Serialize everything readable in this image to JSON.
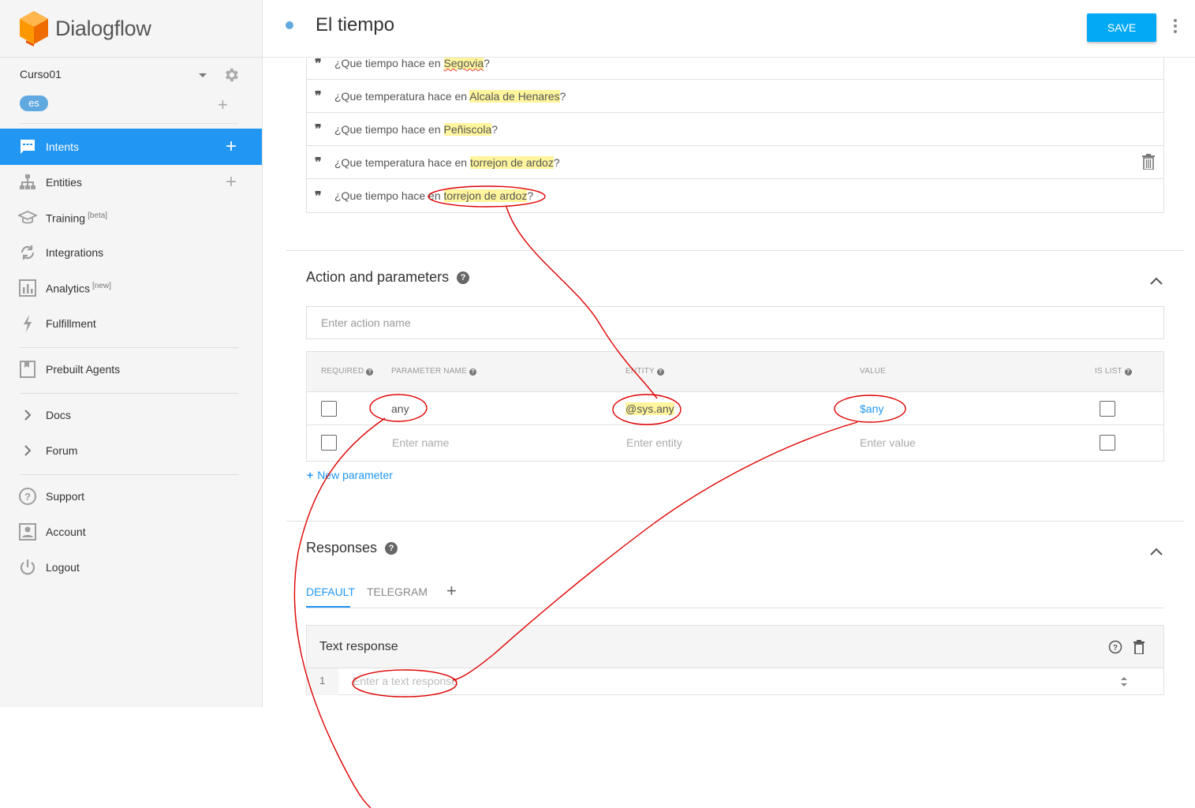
{
  "app": {
    "name": "Dialogflow",
    "brand_color": "#f57c00",
    "accent": "#2196f3"
  },
  "agent": {
    "name": "Curso01",
    "language": "es"
  },
  "sidebar": {
    "items": [
      {
        "label": "Intents",
        "icon": "chat-icon",
        "active": true,
        "has_add": true
      },
      {
        "label": "Entities",
        "icon": "hierarchy-icon",
        "has_add": true
      },
      {
        "label": "Training",
        "tag": "[beta]",
        "icon": "graduation-cap-icon"
      },
      {
        "label": "Integrations",
        "icon": "sync-icon"
      },
      {
        "label": "Analytics",
        "tag": "[new]",
        "icon": "bar-chart-icon"
      },
      {
        "label": "Fulfillment",
        "icon": "lightning-icon"
      },
      {
        "label": "Prebuilt Agents",
        "icon": "bookmark-icon"
      },
      {
        "label": "Docs",
        "icon": "chevron-right-icon"
      },
      {
        "label": "Forum",
        "icon": "chevron-right-icon"
      },
      {
        "label": "Support",
        "icon": "help-circle-icon"
      },
      {
        "label": "Account",
        "icon": "account-box-icon"
      },
      {
        "label": "Logout",
        "icon": "power-icon"
      }
    ]
  },
  "header": {
    "title": "El tiempo",
    "save_label": "SAVE"
  },
  "training_phrases": [
    {
      "before": "¿Que tiempo hace en ",
      "entity": "Segovia",
      "after": "?",
      "misspelled": true
    },
    {
      "before": "¿Que temperatura hace en ",
      "entity": "Alcala de Henares",
      "after": "?"
    },
    {
      "before": "¿Que tiempo hace en ",
      "entity": "Peñiscola",
      "after": "?"
    },
    {
      "before": "¿Que temperatura hace en ",
      "entity": "torrejon de ardoz",
      "after": "?",
      "has_trash": true
    },
    {
      "before": "¿Que tiempo hace en ",
      "entity": "torrejon de ardoz",
      "after": "?"
    }
  ],
  "actions": {
    "title": "Action and parameters",
    "action_placeholder": "Enter action name",
    "columns": {
      "required": "REQUIRED",
      "name": "PARAMETER NAME",
      "entity": "ENTITY",
      "value": "VALUE",
      "is_list": "IS LIST"
    },
    "rows": [
      {
        "name": "any",
        "entity": "@sys.any",
        "value": "$any"
      }
    ],
    "placeholder_row": {
      "name": "Enter name",
      "entity": "Enter entity",
      "value": "Enter value"
    },
    "new_param_label": "New parameter"
  },
  "responses": {
    "title": "Responses",
    "tabs": [
      "DEFAULT",
      "TELEGRAM"
    ],
    "card_title": "Text response",
    "line_number": "1",
    "input_placeholder": "Enter a text response"
  }
}
